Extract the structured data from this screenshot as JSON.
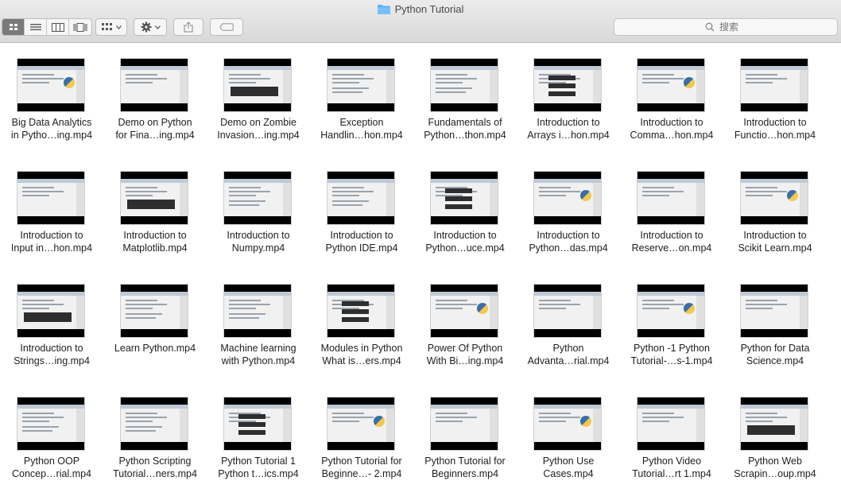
{
  "window": {
    "title": "Python Tutorial",
    "folder_color": "#5aaef5"
  },
  "toolbar": {
    "views": [
      "icon-view",
      "list-view",
      "column-view",
      "cover-flow-view"
    ],
    "active_view": "icon-view",
    "search_placeholder": "搜索"
  },
  "files": [
    {
      "l1": "Big Data Analytics",
      "l2": "in Pytho…ing.mp4"
    },
    {
      "l1": "Demo on Python",
      "l2": "for Fina…ing.mp4"
    },
    {
      "l1": "Demo on Zombie",
      "l2": "Invasion…ing.mp4"
    },
    {
      "l1": "Exception",
      "l2": "Handlin…hon.mp4"
    },
    {
      "l1": "Fundamentals of",
      "l2": "Python…thon.mp4"
    },
    {
      "l1": "Introduction to",
      "l2": "Arrays i…hon.mp4"
    },
    {
      "l1": "Introduction to",
      "l2": "Comma…hon.mp4"
    },
    {
      "l1": "Introduction to",
      "l2": "Functio…hon.mp4"
    },
    {
      "l1": "Introduction to",
      "l2": "Input in…hon.mp4"
    },
    {
      "l1": "Introduction to",
      "l2": "Matplotlib.mp4"
    },
    {
      "l1": "Introduction to",
      "l2": "Numpy.mp4"
    },
    {
      "l1": "Introduction to",
      "l2": "Python IDE.mp4"
    },
    {
      "l1": "Introduction to",
      "l2": "Python…uce.mp4"
    },
    {
      "l1": "Introduction to",
      "l2": "Python…das.mp4"
    },
    {
      "l1": "Introduction to",
      "l2": "Reserve…on.mp4"
    },
    {
      "l1": "Introduction to",
      "l2": "Scikit Learn.mp4"
    },
    {
      "l1": "Introduction to",
      "l2": "Strings…ing.mp4"
    },
    {
      "l1": "Learn Python.mp4",
      "l2": ""
    },
    {
      "l1": "Machine learning",
      "l2": "with Python.mp4"
    },
    {
      "l1": "Modules in Python",
      "l2": "What is…ers.mp4"
    },
    {
      "l1": "Power Of Python",
      "l2": "With Bi…ing.mp4"
    },
    {
      "l1": "Python",
      "l2": "Advanta…rial.mp4"
    },
    {
      "l1": "Python -1   Python",
      "l2": "Tutorial-…s-1.mp4"
    },
    {
      "l1": "Python for Data",
      "l2": "Science.mp4"
    },
    {
      "l1": "Python OOP",
      "l2": "Concep…rial.mp4"
    },
    {
      "l1": "Python Scripting",
      "l2": "Tutorial…ners.mp4"
    },
    {
      "l1": "Python Tutorial 1",
      "l2": "Python t…ics.mp4"
    },
    {
      "l1": "Python Tutorial for",
      "l2": "Beginne…- 2.mp4"
    },
    {
      "l1": "Python Tutorial for",
      "l2": "Beginners.mp4"
    },
    {
      "l1": "Python Use",
      "l2": "Cases.mp4"
    },
    {
      "l1": "Python Video",
      "l2": "Tutorial…rt 1.mp4"
    },
    {
      "l1": "Python Web",
      "l2": "Scrapin…oup.mp4"
    }
  ]
}
